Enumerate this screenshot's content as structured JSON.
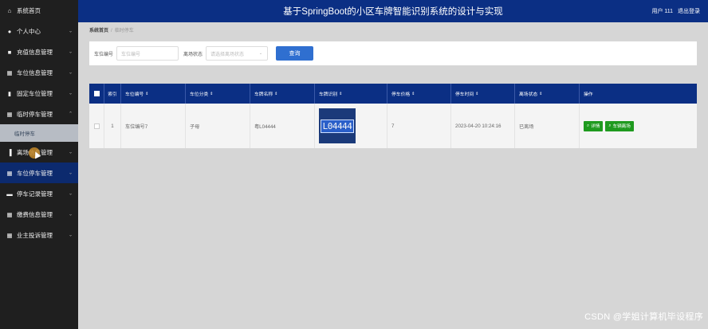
{
  "sidebar": {
    "items": [
      {
        "label": "系统首页",
        "icon": "home-icon",
        "glyph": "⌂"
      },
      {
        "label": "个人中心",
        "icon": "user-icon",
        "glyph": "●"
      },
      {
        "label": "充值信息管理",
        "icon": "wallet-icon",
        "glyph": "■"
      },
      {
        "label": "车位信息管理",
        "icon": "grid-icon",
        "glyph": "▦"
      },
      {
        "label": "固定车位管理",
        "icon": "book-icon",
        "glyph": "▮"
      },
      {
        "label": "临时停车管理",
        "icon": "grid-icon",
        "glyph": "▦"
      },
      {
        "label": "离场信息管理",
        "icon": "chart-icon",
        "glyph": "▐"
      },
      {
        "label": "车位停车管理",
        "icon": "grid-icon",
        "glyph": "▦"
      },
      {
        "label": "停车记录管理",
        "icon": "ticket-icon",
        "glyph": "▬"
      },
      {
        "label": "缴费信息管理",
        "icon": "grid-icon",
        "glyph": "▦"
      },
      {
        "label": "业主投诉管理",
        "icon": "grid-icon",
        "glyph": "▦"
      }
    ],
    "sub_item": "临时停车"
  },
  "header": {
    "title": "基于SpringBoot的小区车牌智能识别系统的设计与实现",
    "user": "用户 111",
    "logout": "退出登录"
  },
  "breadcrumb": {
    "home": "系统首页",
    "current": "临时停车"
  },
  "search": {
    "field1_label": "车位编号",
    "field1_placeholder": "车位编号",
    "field2_label": "离场状态",
    "field2_placeholder": "请选择离场状态",
    "button": "查询"
  },
  "table": {
    "headers": [
      "索引",
      "车位编号",
      "车位分类",
      "车牌名称",
      "车牌识别",
      "停车价格",
      "停车时间",
      "离场状态",
      "操作"
    ],
    "rows": [
      {
        "index": "1",
        "spot_no": "车位编号7",
        "category": "子母",
        "plate_name": "粤L04444",
        "plate_image_text": "L04444",
        "price": "7",
        "time": "2023-04-20 10:24:16",
        "status": "已离场",
        "actions": [
          "详情",
          "车辆离场"
        ]
      }
    ]
  },
  "watermark": "CSDN @学姐计算机毕设程序",
  "colors": {
    "header": "#0b2f84",
    "sidebar": "#1f1f1f",
    "accent_button": "#2f6fd0",
    "action_button": "#1f9a1f"
  }
}
